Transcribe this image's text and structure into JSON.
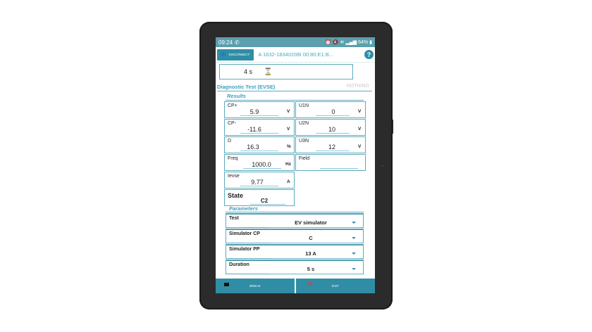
{
  "status_bar": {
    "time": "09:24",
    "phone_icon": "phone-icon",
    "battery": "64%"
  },
  "app_bar": {
    "disconnect_label": "DISCONNECT",
    "device_id": "A 1632-18340208I 00:80:E1:B...",
    "help": "?"
  },
  "timer": {
    "value": "4 s",
    "icon": "hourglass-icon"
  },
  "diagnostic": {
    "title": "Diagnostic Test (EVSE)",
    "status": "NOTHING",
    "results_label": "Results"
  },
  "results_left": [
    {
      "label": "CP+",
      "value": "5.9",
      "unit": "V"
    },
    {
      "label": "CP-",
      "value": "-11.6",
      "unit": "V"
    },
    {
      "label": "D",
      "value": "16.3",
      "unit": "%"
    },
    {
      "label": "Freq",
      "value": "1000.0",
      "unit": "Hz"
    },
    {
      "label": "Ievse",
      "value": "9.77",
      "unit": "A"
    }
  ],
  "state": {
    "label": "State",
    "value": "C2"
  },
  "results_right": [
    {
      "label": "U1N",
      "value": "0",
      "unit": "V"
    },
    {
      "label": "U2N",
      "value": "10",
      "unit": "V"
    },
    {
      "label": "U3N",
      "value": "12",
      "unit": "V"
    },
    {
      "label": "Field",
      "value": "",
      "unit": ""
    }
  ],
  "parameters": {
    "label": "Parameters",
    "items": [
      {
        "label": "Test",
        "value": "EV simulator"
      },
      {
        "label": "Simulator CP",
        "value": "C"
      },
      {
        "label": "Simulator PP",
        "value": "13 A"
      },
      {
        "label": "Duration",
        "value": "5 s"
      }
    ]
  },
  "bottom": {
    "break_label": "BREAK",
    "exit_label": "EXIT"
  },
  "colors": {
    "accent": "#2f8ea5",
    "status_bar": "#5c9fae",
    "title": "#3f9fbb",
    "border": "#5cabc0"
  }
}
